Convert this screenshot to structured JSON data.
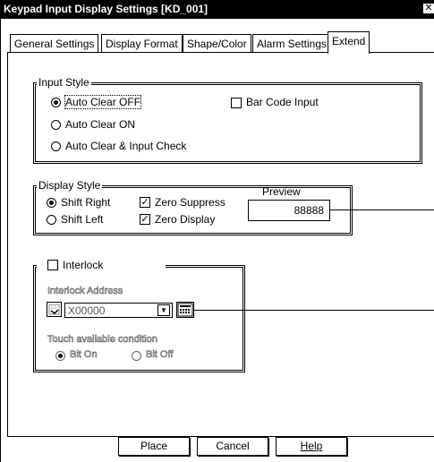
{
  "window": {
    "title": "Keypad Input Display Settings [KD_001]",
    "close_glyph": "✕"
  },
  "tabs": [
    {
      "label": "General Settings"
    },
    {
      "label": "Display Format"
    },
    {
      "label": "Shape/Color"
    },
    {
      "label": "Alarm Settings"
    },
    {
      "label": "Extend",
      "active": true
    }
  ],
  "input_style": {
    "legend": "Input Style",
    "options": [
      {
        "label": "Auto Clear OFF",
        "selected": true
      },
      {
        "label": "Auto Clear ON",
        "selected": false
      },
      {
        "label": "Auto Clear & Input Check",
        "selected": false
      }
    ],
    "bar_code": {
      "label": "Bar Code Input",
      "checked": false
    }
  },
  "display_style": {
    "legend": "Display Style",
    "options": [
      {
        "label": "Shift Right",
        "selected": true
      },
      {
        "label": "Shift Left",
        "selected": false
      }
    ],
    "zero_suppress": {
      "label": "Zero Suppress",
      "checked": true
    },
    "zero_display": {
      "label": "Zero Display",
      "checked": true
    },
    "preview_label": "Preview",
    "preview_value": "88888"
  },
  "interlock": {
    "label": "Interlock",
    "checked": false,
    "address_label": "Interlock Address",
    "address_value": "X00000",
    "condition_label": "Touch available condition",
    "options": [
      {
        "label": "Bit On",
        "selected": true
      },
      {
        "label": "Bit Off",
        "selected": false
      }
    ]
  },
  "buttons": {
    "place": "Place",
    "cancel": "Cancel",
    "help": "Help"
  }
}
